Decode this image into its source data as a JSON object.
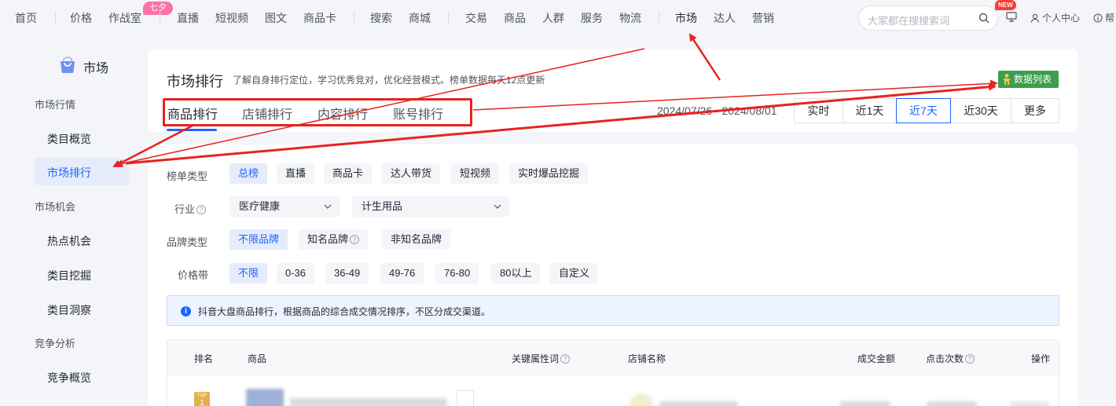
{
  "topnav": {
    "items": [
      "首页",
      "价格",
      "作战室",
      "直播",
      "短视频",
      "图文",
      "商品卡",
      "搜索",
      "商城",
      "交易",
      "商品",
      "人群",
      "服务",
      "物流",
      "市场",
      "达人",
      "营销"
    ],
    "active": "市场",
    "qixi_badge": "七夕",
    "search_placeholder": "大家都在搜搜索词",
    "new_badge": "NEW",
    "personal_center": "个人中心",
    "help": "帮"
  },
  "sidebar": {
    "title": "市场",
    "groups": [
      {
        "label": "市场行情",
        "items": [
          "类目概览",
          "市场排行"
        ]
      },
      {
        "label": "市场机会",
        "items": [
          "热点机会",
          "类目挖掘",
          "类目洞察"
        ]
      },
      {
        "label": "竞争分析",
        "items": [
          "竞争概览"
        ]
      }
    ],
    "active_item": "市场排行"
  },
  "header": {
    "title": "市场排行",
    "description": "了解自身排行定位，学习优秀竞对，优化经营模式。榜单数据每天12点更新",
    "data_list_button": "数据列表",
    "tabs": [
      "商品排行",
      "店铺排行",
      "内容排行",
      "账号排行"
    ],
    "active_tab": "商品排行",
    "date_range": "2024/07/26 - 2024/08/01",
    "time_options": [
      "实时",
      "近1天",
      "近7天",
      "近30天",
      "更多"
    ],
    "active_time": "近7天"
  },
  "filters": {
    "list_type": {
      "label": "榜单类型",
      "options": [
        "总榜",
        "直播",
        "商品卡",
        "达人带货",
        "短视频",
        "实时爆品挖掘"
      ],
      "active": "总榜"
    },
    "industry": {
      "label": "行业",
      "level1": "医疗健康",
      "level2": "计生用品"
    },
    "brand_type": {
      "label": "品牌类型",
      "options": [
        "不限品牌",
        "知名品牌",
        "非知名品牌"
      ],
      "active": "不限品牌"
    },
    "price": {
      "label": "价格带",
      "options": [
        "不限",
        "0-36",
        "36-49",
        "49-76",
        "76-80",
        "80以上",
        "自定义"
      ],
      "active": "不限"
    }
  },
  "notice": "抖音大盘商品排行，根据商品的综合成交情况排序，不区分成交渠道。",
  "table": {
    "columns": [
      "排名",
      "商品",
      "关键属性词",
      "店铺名称",
      "成交金额",
      "点击次数",
      "操作"
    ],
    "first_row": {
      "rank_badge_top": "TOP",
      "rank_badge_num": "1"
    }
  },
  "colors": {
    "accent": "#1966ff",
    "annotation": "#e8231f",
    "data_list_btn": "#3c9e4f",
    "qixi_badge": "#ff6fa8"
  }
}
